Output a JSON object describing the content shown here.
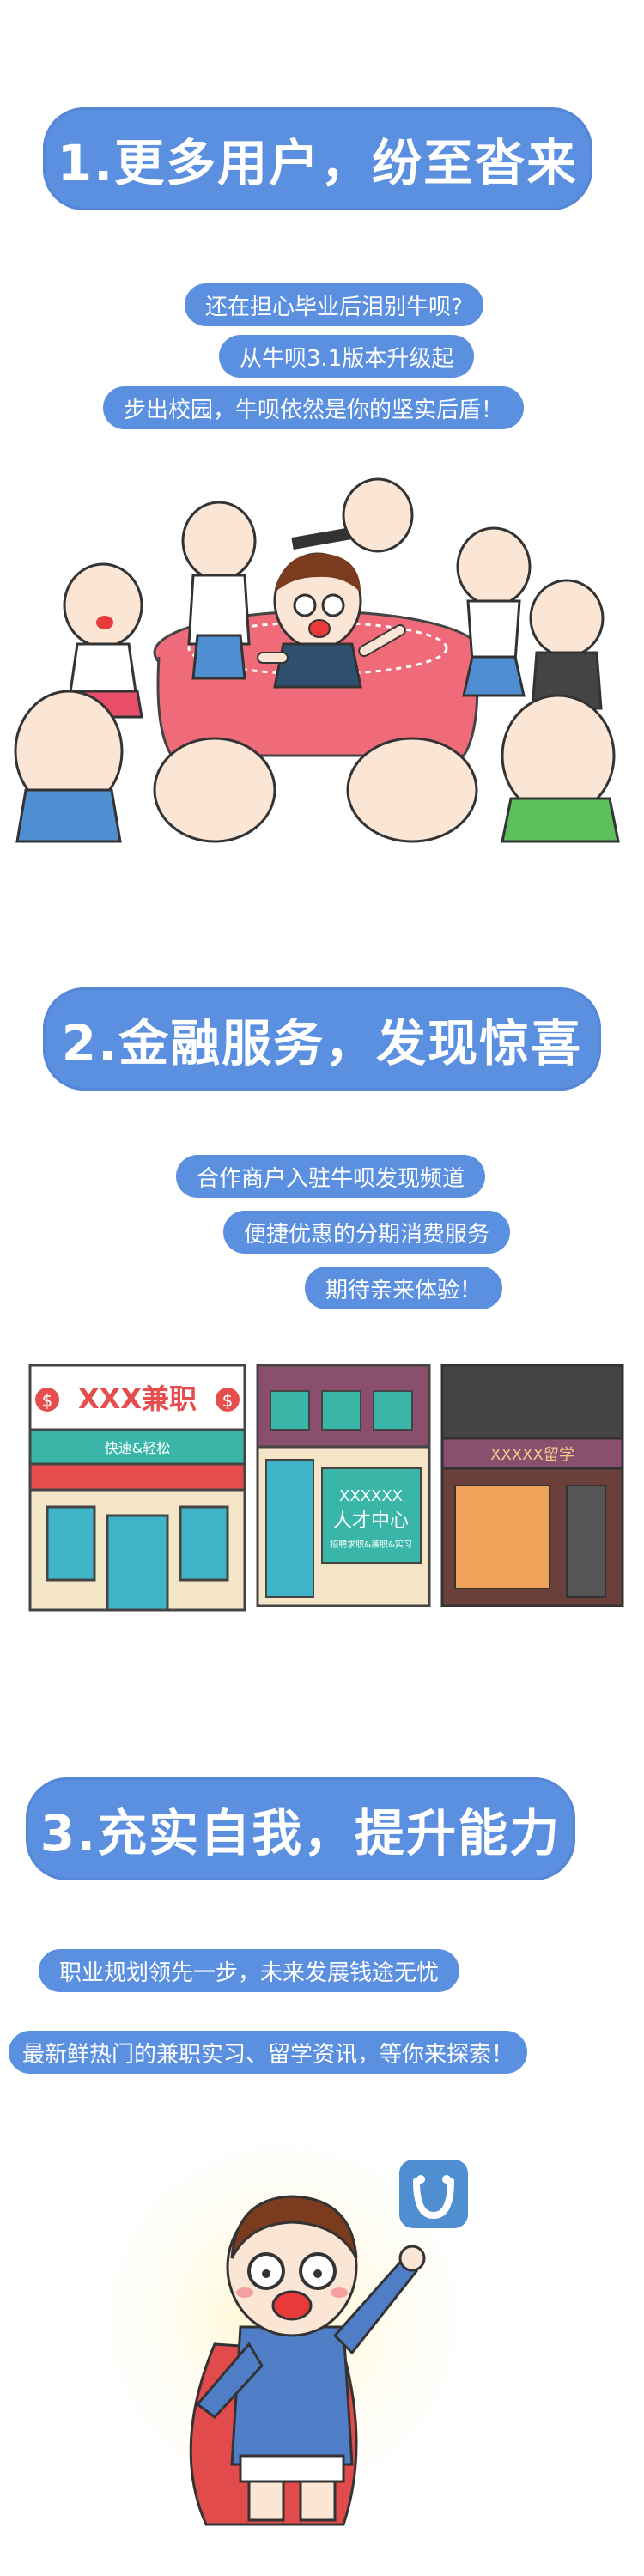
{
  "section1": {
    "title": "1.更多用户，纷至沓来",
    "lines": [
      "还在担心毕业后泪别牛呗?",
      "从牛呗3.1版本升级起",
      "步出校园，牛呗依然是你的坚实后盾！"
    ]
  },
  "section2": {
    "title": "2.金融服务，发现惊喜",
    "lines": [
      "合作商户入驻牛呗发现频道",
      "便捷优惠的分期消费服务",
      "期待亲来体验！"
    ],
    "shops": [
      {
        "sign": "XXX兼职",
        "sub": "快速&轻松",
        "dollar": "$"
      },
      {
        "sign": "XXXXXX",
        "sub": "人才中心",
        "small": "招聘求职&兼职&实习"
      },
      {
        "sign": "XXXXX留学"
      }
    ]
  },
  "section3": {
    "title": "3.充实自我，提升能力",
    "lines": [
      "职业规划领先一步，未来发展钱途无忧",
      "最新鲜热门的兼职实习、留学资讯，等你来探索！"
    ]
  },
  "colors": {
    "accent": "#5b8fe0",
    "table": "#f06b7a",
    "skin": "#fbe6d6"
  }
}
